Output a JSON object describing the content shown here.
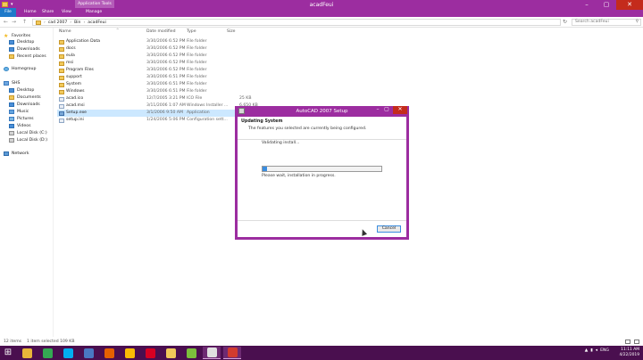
{
  "window": {
    "title": "acadFeui",
    "context_tab": "Application Tools",
    "controls": {
      "minimize": "–",
      "maximize": "▢",
      "close": "✕"
    }
  },
  "ribbon": {
    "tabs": [
      "File",
      "Home",
      "Share",
      "View",
      "Manage"
    ]
  },
  "address": {
    "crumbs": [
      "cad 2007",
      "Bin",
      "acadFeui"
    ],
    "separator": "›",
    "search_placeholder": "Search acadFeui",
    "search_icon": "⚲",
    "refresh_icon": "↻",
    "back_icon": "←",
    "forward_icon": "→",
    "up_icon": "↑"
  },
  "sidebar": {
    "items": [
      {
        "label": "Favorites",
        "icon": "star-icon"
      },
      {
        "label": "Desktop",
        "icon": "desktop-icon"
      },
      {
        "label": "Downloads",
        "icon": "downloads-icon"
      },
      {
        "label": "Recent places",
        "icon": "recent-icon"
      },
      {
        "label": "Homegroup",
        "icon": "homegroup-icon"
      },
      {
        "label": "SHS",
        "icon": "computer-icon"
      },
      {
        "label": "Desktop",
        "icon": "desktop-icon"
      },
      {
        "label": "Documents",
        "icon": "documents-icon"
      },
      {
        "label": "Downloads",
        "icon": "downloads-icon"
      },
      {
        "label": "Music",
        "icon": "music-icon"
      },
      {
        "label": "Pictures",
        "icon": "pictures-icon"
      },
      {
        "label": "Videos",
        "icon": "videos-icon"
      },
      {
        "label": "Local Disk (C:)",
        "icon": "drive-icon"
      },
      {
        "label": "Local Disk (D:)",
        "icon": "drive-icon"
      },
      {
        "label": "Network",
        "icon": "network-icon"
      }
    ]
  },
  "columns": {
    "name": "Name",
    "date": "Date modified",
    "type": "Type",
    "size": "Size"
  },
  "files": [
    {
      "name": "Application Data",
      "date": "3/30/2006 6:52 PM",
      "type": "File folder",
      "size": "",
      "kind": "folder"
    },
    {
      "name": "docs",
      "date": "3/30/2006 6:52 PM",
      "type": "File folder",
      "size": "",
      "kind": "folder"
    },
    {
      "name": "eula",
      "date": "3/30/2006 6:52 PM",
      "type": "File folder",
      "size": "",
      "kind": "folder"
    },
    {
      "name": "msi",
      "date": "3/30/2006 6:52 PM",
      "type": "File folder",
      "size": "",
      "kind": "folder"
    },
    {
      "name": "Program Files",
      "date": "3/30/2006 6:52 PM",
      "type": "File folder",
      "size": "",
      "kind": "folder"
    },
    {
      "name": "support",
      "date": "3/30/2006 6:51 PM",
      "type": "File folder",
      "size": "",
      "kind": "folder"
    },
    {
      "name": "System",
      "date": "3/30/2006 6:51 PM",
      "type": "File folder",
      "size": "",
      "kind": "folder"
    },
    {
      "name": "Windows",
      "date": "3/30/2006 6:51 PM",
      "type": "File folder",
      "size": "",
      "kind": "folder"
    },
    {
      "name": "acad.ico",
      "date": "12/7/2005 3:21 PM",
      "type": "ICO File",
      "size": "25 KB",
      "kind": "file"
    },
    {
      "name": "acad.msi",
      "date": "3/11/2006 1:07 AM",
      "type": "Windows Installer ...",
      "size": "6,650 KB",
      "kind": "file"
    },
    {
      "name": "Setup.exe",
      "date": "3/1/2006 9:50 AM",
      "type": "Application",
      "size": "",
      "kind": "app"
    },
    {
      "name": "setup.ini",
      "date": "1/24/2006 5:06 PM",
      "type": "Configuration sett...",
      "size": "",
      "kind": "file"
    }
  ],
  "dialog": {
    "title": "AutoCAD 2007 Setup",
    "heading": "Updating System",
    "subheading": "The features you selected are currently being configured.",
    "status": "Validating install...",
    "progress": 0.04,
    "message": "Please wait, installation in progress.",
    "cancel_label": "Cancel"
  },
  "statusbar": {
    "items": "12 items",
    "selection": "1 item selected  109 KB"
  },
  "taskbar": {
    "start_icon": "⊞",
    "apps": [
      {
        "name": "file-explorer-icon",
        "color": "#e7b53a"
      },
      {
        "name": "chrome-icon",
        "color": "#34a853"
      },
      {
        "name": "skype-icon",
        "color": "#00aff0"
      },
      {
        "name": "camera-icon",
        "color": "#4a78c2"
      },
      {
        "name": "firefox-icon",
        "color": "#e66000"
      },
      {
        "name": "chrome-icon",
        "color": "#fbbc05"
      },
      {
        "name": "opera-icon",
        "color": "#d70022"
      },
      {
        "name": "file-explorer-icon",
        "color": "#f1c95a"
      },
      {
        "name": "autocad-icon",
        "color": "#7cbf3c"
      },
      {
        "name": "setup-icon",
        "color": "#e0e0e0"
      },
      {
        "name": "autocad-red-icon",
        "color": "#d13b2e"
      }
    ],
    "tray_lang": "ENG",
    "time": "11:11 AM",
    "date": "4/22/2019"
  },
  "colors": {
    "accent": "#9c2da0",
    "taskbar": "#4a0f4f",
    "progress": "#3a8de0",
    "selection": "#cce8ff"
  }
}
